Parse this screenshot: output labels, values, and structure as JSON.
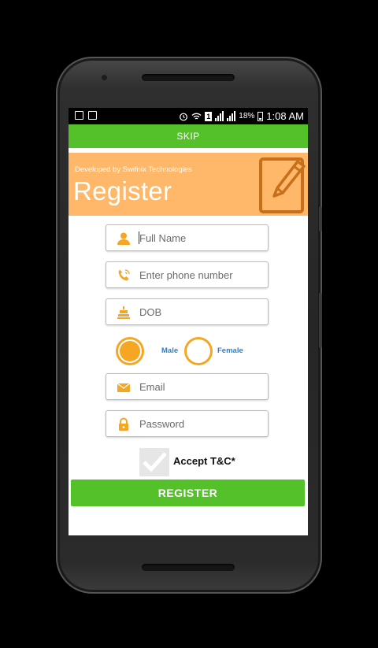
{
  "status_bar": {
    "battery_percent": "18%",
    "time": "1:08 AM",
    "sim_label": "1",
    "icons": [
      "image-notification-icon",
      "mail-notification-icon",
      "alarm-icon",
      "wifi-icon",
      "sim-icon",
      "signal-icon",
      "battery-icon"
    ]
  },
  "skip": {
    "label": "SKIP"
  },
  "banner": {
    "developer": "Developed by Swifnix Technologies",
    "title": "Register",
    "icon": "edit-pencil-icon"
  },
  "form": {
    "full_name": {
      "placeholder": "Full Name",
      "icon": "user-icon"
    },
    "phone": {
      "placeholder": "Enter phone number",
      "icon": "phone-icon"
    },
    "dob": {
      "placeholder": "DOB",
      "icon": "cake-icon"
    },
    "gender": {
      "male": "Male",
      "female": "Female",
      "selected": "Male"
    },
    "email": {
      "placeholder": "Email",
      "icon": "envelope-icon"
    },
    "password": {
      "placeholder": "Password",
      "icon": "lock-icon"
    },
    "accept": {
      "label": "Accept T&C*",
      "checked": true
    },
    "register_button": "REGISTER"
  },
  "colors": {
    "green": "#55c12a",
    "banner_orange": "#ffb86a",
    "icon_orange": "#f5a623",
    "link_blue": "#2a7fd0"
  }
}
